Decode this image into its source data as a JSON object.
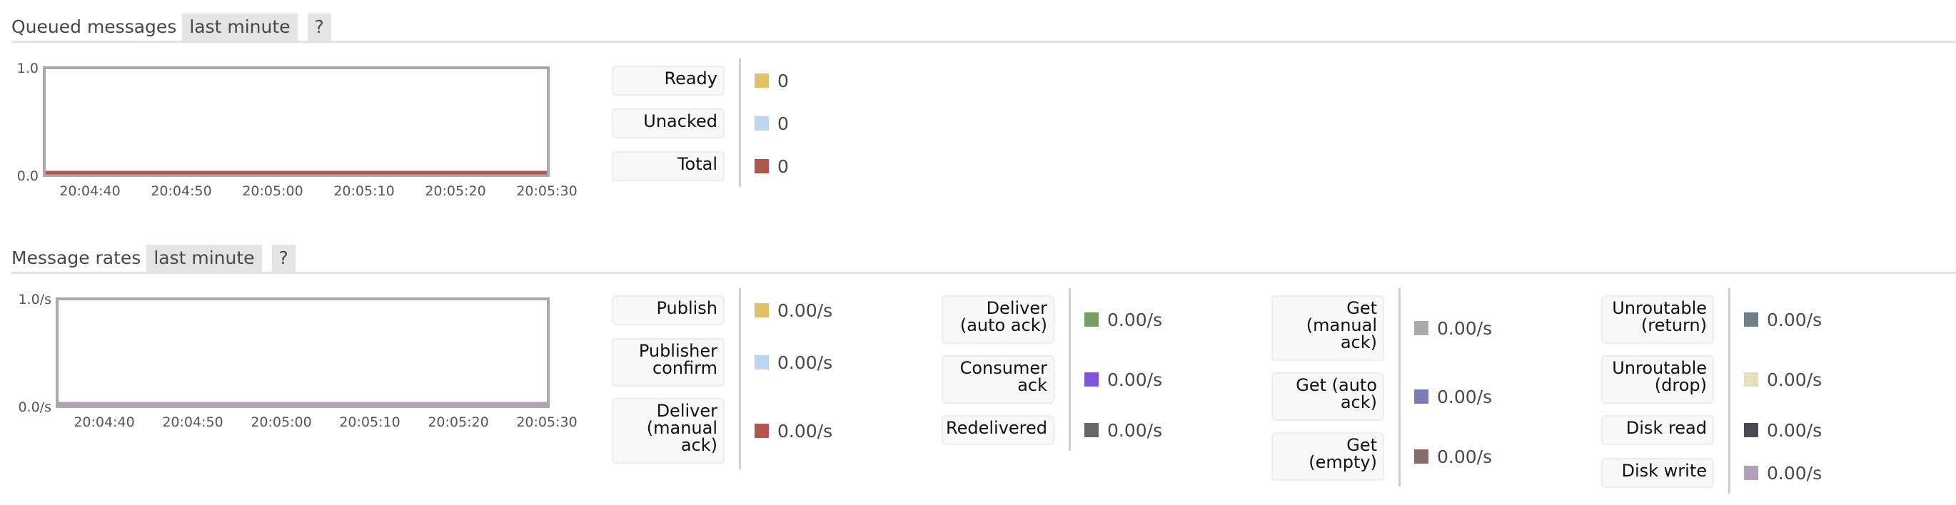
{
  "queued": {
    "title": "Queued messages",
    "range_label": "last minute",
    "help_label": "?",
    "chart_data": {
      "type": "line",
      "title": "Queued messages",
      "xlabel": "",
      "ylabel": "",
      "x": [
        "20:04:40",
        "20:04:50",
        "20:05:00",
        "20:05:10",
        "20:05:20",
        "20:05:30"
      ],
      "y_ticks": [
        "0.0",
        "1.0"
      ],
      "ylim": [
        0,
        1
      ],
      "series": [
        {
          "name": "Ready",
          "color": "#e0c068",
          "values": [
            0,
            0,
            0,
            0,
            0,
            0
          ]
        },
        {
          "name": "Unacked",
          "color": "#bcd6ef",
          "values": [
            0,
            0,
            0,
            0,
            0,
            0
          ]
        },
        {
          "name": "Total",
          "color": "#b05750",
          "values": [
            0,
            0,
            0,
            0,
            0,
            0
          ]
        }
      ],
      "visible_line_color": "#b05750"
    },
    "legend": [
      {
        "label": "Ready",
        "value": "0",
        "color": "#e0c068"
      },
      {
        "label": "Unacked",
        "value": "0",
        "color": "#bcd6ef"
      },
      {
        "label": "Total",
        "value": "0",
        "color": "#b05750"
      }
    ]
  },
  "rates": {
    "title": "Message rates",
    "range_label": "last minute",
    "help_label": "?",
    "chart_data": {
      "type": "line",
      "title": "Message rates",
      "xlabel": "",
      "ylabel": "",
      "x": [
        "20:04:40",
        "20:04:50",
        "20:05:00",
        "20:05:10",
        "20:05:20",
        "20:05:30"
      ],
      "y_ticks": [
        "0.0/s",
        "1.0/s"
      ],
      "ylim": [
        0,
        1
      ],
      "series": [
        {
          "name": "Publish",
          "color": "#e0c068",
          "values": [
            0,
            0,
            0,
            0,
            0,
            0
          ]
        },
        {
          "name": "Publisher confirm",
          "color": "#bcd6ef",
          "values": [
            0,
            0,
            0,
            0,
            0,
            0
          ]
        },
        {
          "name": "Deliver (manual ack)",
          "color": "#b05750",
          "values": [
            0,
            0,
            0,
            0,
            0,
            0
          ]
        },
        {
          "name": "Deliver (auto ack)",
          "color": "#74a15f",
          "values": [
            0,
            0,
            0,
            0,
            0,
            0
          ]
        },
        {
          "name": "Consumer ack",
          "color": "#8154d9",
          "values": [
            0,
            0,
            0,
            0,
            0,
            0
          ]
        },
        {
          "name": "Redelivered",
          "color": "#676767",
          "values": [
            0,
            0,
            0,
            0,
            0,
            0
          ]
        },
        {
          "name": "Get (manual ack)",
          "color": "#a9a9a9",
          "values": [
            0,
            0,
            0,
            0,
            0,
            0
          ]
        },
        {
          "name": "Get (auto ack)",
          "color": "#7b7bb9",
          "values": [
            0,
            0,
            0,
            0,
            0,
            0
          ]
        },
        {
          "name": "Get (empty)",
          "color": "#876a6a",
          "values": [
            0,
            0,
            0,
            0,
            0,
            0
          ]
        },
        {
          "name": "Unroutable (return)",
          "color": "#6f808a",
          "values": [
            0,
            0,
            0,
            0,
            0,
            0
          ]
        },
        {
          "name": "Unroutable (drop)",
          "color": "#e6e1bc",
          "values": [
            0,
            0,
            0,
            0,
            0,
            0
          ]
        },
        {
          "name": "Disk read",
          "color": "#4a4a52",
          "values": [
            0,
            0,
            0,
            0,
            0,
            0
          ]
        },
        {
          "name": "Disk write",
          "color": "#b09fbb",
          "values": [
            0,
            0,
            0,
            0,
            0,
            0
          ]
        }
      ],
      "visible_line_color": "#b09fbb"
    },
    "legend_columns": [
      [
        {
          "label": "Publish",
          "value": "0.00/s",
          "color": "#e0c068"
        },
        {
          "label": "Publisher\nconfirm",
          "value": "0.00/s",
          "color": "#bcd6ef"
        },
        {
          "label": "Deliver\n(manual\nack)",
          "value": "0.00/s",
          "color": "#b05750"
        }
      ],
      [
        {
          "label": "Deliver\n(auto ack)",
          "value": "0.00/s",
          "color": "#74a15f"
        },
        {
          "label": "Consumer\nack",
          "value": "0.00/s",
          "color": "#8154d9"
        },
        {
          "label": "Redelivered",
          "value": "0.00/s",
          "color": "#676767"
        }
      ],
      [
        {
          "label": "Get\n(manual\nack)",
          "value": "0.00/s",
          "color": "#a9a9a9"
        },
        {
          "label": "Get (auto\nack)",
          "value": "0.00/s",
          "color": "#7b7bb9"
        },
        {
          "label": "Get\n(empty)",
          "value": "0.00/s",
          "color": "#876a6a"
        }
      ],
      [
        {
          "label": "Unroutable\n(return)",
          "value": "0.00/s",
          "color": "#6f808a"
        },
        {
          "label": "Unroutable\n(drop)",
          "value": "0.00/s",
          "color": "#e6e1bc"
        },
        {
          "label": "Disk read",
          "value": "0.00/s",
          "color": "#4a4a52"
        },
        {
          "label": "Disk write",
          "value": "0.00/s",
          "color": "#b09fbb"
        }
      ]
    ]
  }
}
